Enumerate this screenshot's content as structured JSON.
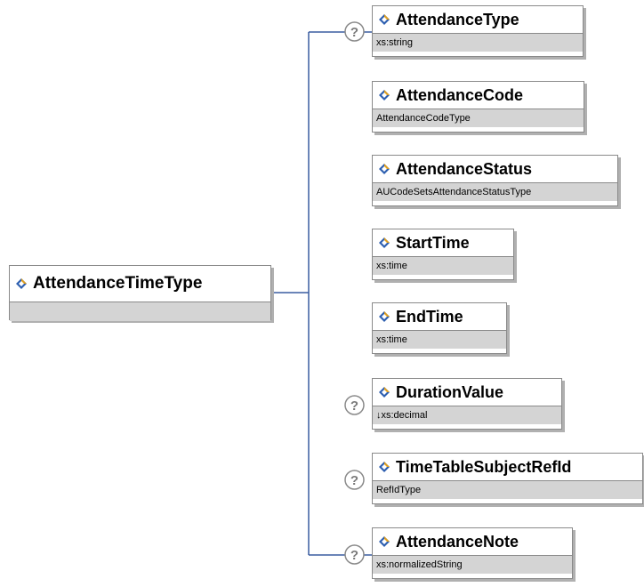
{
  "root": {
    "name": "AttendanceTimeType",
    "icon": "element-icon"
  },
  "children": [
    {
      "name": "AttendanceType",
      "type": "xs:string",
      "optional": true
    },
    {
      "name": "AttendanceCode",
      "type": "AttendanceCodeType",
      "optional": false
    },
    {
      "name": "AttendanceStatus",
      "type": "AUCodeSetsAttendanceStatusType",
      "optional": false
    },
    {
      "name": "StartTime",
      "type": "xs:time",
      "optional": false
    },
    {
      "name": "EndTime",
      "type": "xs:time",
      "optional": false
    },
    {
      "name": "DurationValue",
      "type": "↓xs:decimal",
      "optional": true
    },
    {
      "name": "TimeTableSubjectRefId",
      "type": "RefIdType",
      "optional": true
    },
    {
      "name": "AttendanceNote",
      "type": "xs:normalizedString",
      "optional": true
    }
  ],
  "colors": {
    "connector": "#3a5da0",
    "header_bg": "#ffffff",
    "type_bg": "#d4d4d4",
    "border": "#8a8a8a",
    "icon_blue": "#2d5fb0",
    "icon_gold": "#e0a020",
    "optional_badge": "#8a8a8a"
  }
}
